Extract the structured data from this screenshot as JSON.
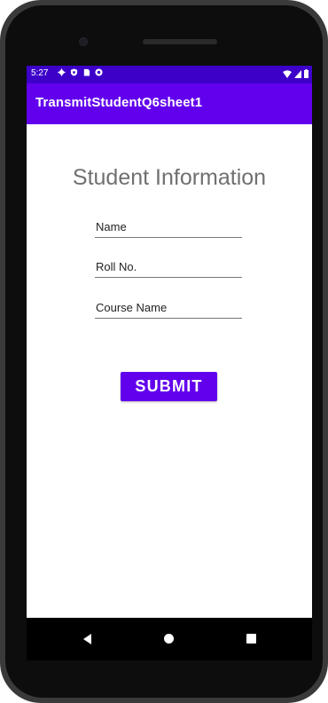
{
  "status_bar": {
    "time": "5:27",
    "left_icons": [
      "settings-icon",
      "shield-icon",
      "sd-card-icon",
      "notification-icon"
    ],
    "right_icons": [
      "wifi-icon",
      "signal-icon",
      "battery-icon"
    ]
  },
  "app_bar": {
    "title": "TransmitStudentQ6sheet1",
    "color": "#6200ee"
  },
  "form": {
    "heading": "Student Information",
    "name_placeholder": "Name",
    "roll_placeholder": "Roll No.",
    "course_placeholder": "Course Name",
    "submit_label": "SUBMIT"
  },
  "nav_bar": {
    "icons": [
      "back-icon",
      "home-icon",
      "recents-icon"
    ]
  },
  "colors": {
    "accent": "#6200ee",
    "status_bar": "#3c00c9"
  }
}
